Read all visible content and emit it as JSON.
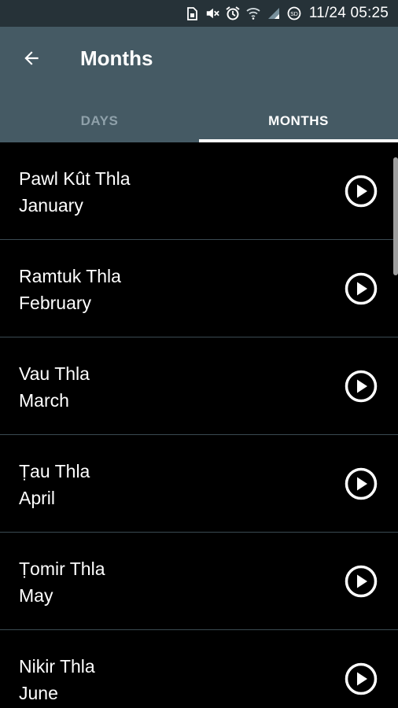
{
  "status_bar": {
    "time": "11/24 05:25",
    "icons": [
      "sim-icon",
      "mute-icon",
      "alarm-icon",
      "wifi-icon",
      "signal-icon",
      "data-saver-icon"
    ]
  },
  "app_bar": {
    "back_icon": "arrow-back-icon",
    "title": "Months",
    "background": "#455a64"
  },
  "tabs": [
    {
      "label": "DAYS",
      "active": false
    },
    {
      "label": "MONTHS",
      "active": true
    }
  ],
  "months": [
    {
      "title": "Pawl Kût Thla",
      "subtitle": "January"
    },
    {
      "title": "Ramtuk Thla",
      "subtitle": "February"
    },
    {
      "title": "Vau Thla",
      "subtitle": "March"
    },
    {
      "title": "Ṭau Thla",
      "subtitle": "April"
    },
    {
      "title": "Ṭomir Thla",
      "subtitle": "May"
    },
    {
      "title": "Nikir Thla",
      "subtitle": "June"
    }
  ],
  "item_icon": "play-circle-icon"
}
